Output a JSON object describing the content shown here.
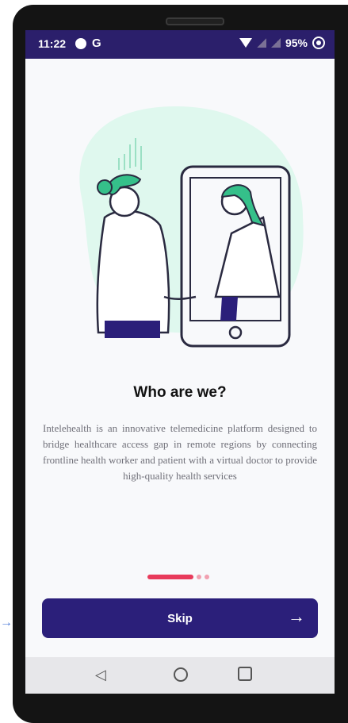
{
  "status_bar": {
    "time": "11:22",
    "carrier_glyph": "G",
    "battery_percent": "95%"
  },
  "onboarding": {
    "title": "Who are we?",
    "description": "Intelehealth is an innovative telemedicine platform designed to bridge healthcare access gap in remote regions by connecting frontline health worker and patient with a virtual doctor to provide high-quality health services",
    "skip_label": "Skip",
    "skip_icon": "arrow-right-icon"
  },
  "pager": {
    "active_index": 0,
    "count": 3
  },
  "colors": {
    "status_bar": "#2b1f6b",
    "primary": "#2b1f7a",
    "accent": "#e83b5b",
    "illustration_blob": "#dff8ee",
    "illustration_green": "#35c08a"
  }
}
